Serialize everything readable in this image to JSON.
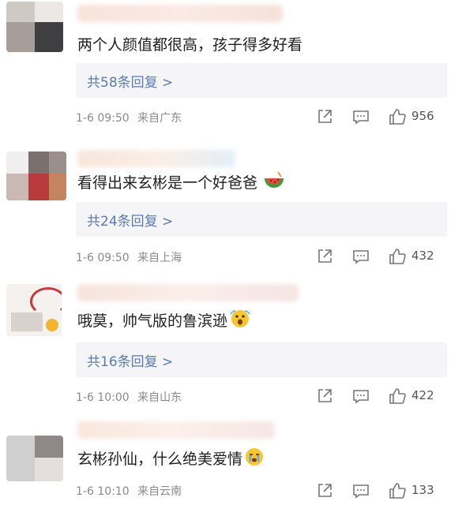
{
  "comments": [
    {
      "text": "两个人颜值都很高，孩子得多好看",
      "replies": "共58条回复 >",
      "time": "1-6 09:50",
      "location": "来自广东",
      "likes": "956",
      "emoji": ""
    },
    {
      "text": "看得出来玄彬是一个好爸爸",
      "replies": "共24条回复 >",
      "time": "1-6 09:50",
      "location": "来自上海",
      "likes": "432",
      "emoji": "watermelon-icon"
    },
    {
      "text": "哦莫，帅气版的鲁滨逊",
      "replies": "共16条回复 >",
      "time": "1-6 10:00",
      "location": "来自山东",
      "likes": "422",
      "emoji": "surprised-face-icon"
    },
    {
      "text": "玄彬孙仙，什么绝美爱情",
      "replies": "",
      "time": "1-6 10:10",
      "location": "来自云南",
      "likes": "133",
      "emoji": "crying-face-icon"
    }
  ],
  "icons": {
    "share": "share-icon",
    "comment": "comment-icon",
    "like": "thumbs-up-icon"
  },
  "colors": {
    "reply_link": "#5b7bae",
    "reply_bg": "#f5f5f7",
    "meta_text": "#8a8a8a"
  }
}
